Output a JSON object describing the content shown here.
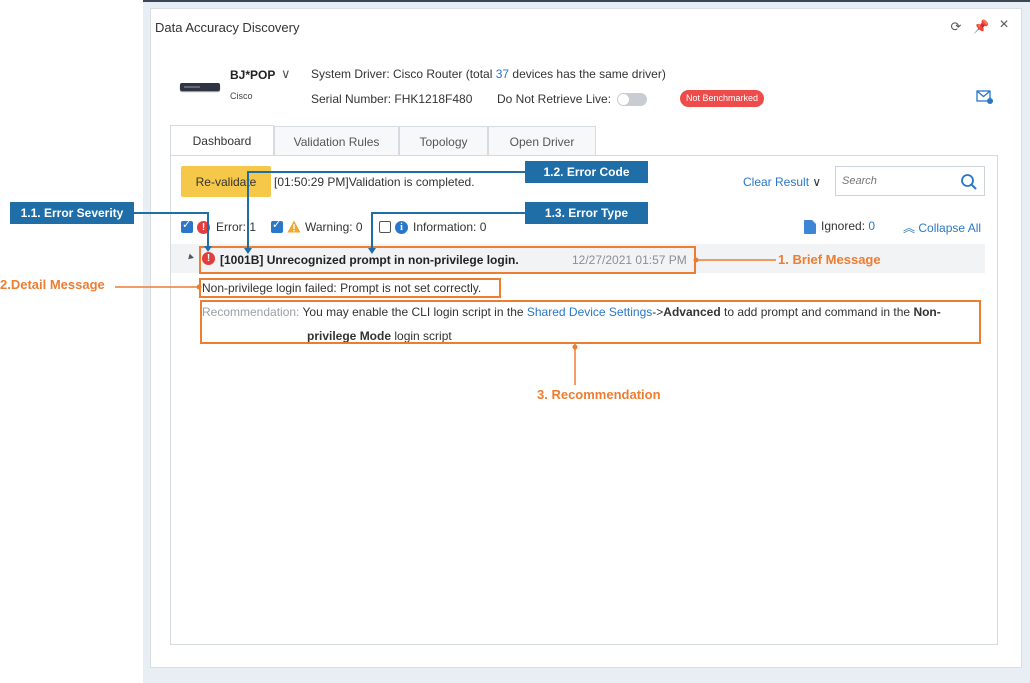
{
  "window": {
    "title": "Data Accuracy Discovery"
  },
  "device": {
    "name": "BJ*POP",
    "vendor": "Cisco",
    "driver_prefix": "System Driver: Cisco Router (total ",
    "driver_count": "37",
    "driver_suffix": " devices has the same driver)",
    "serial": "Serial Number: FHK1218F480",
    "retrieve_label": "Do Not Retrieve Live:",
    "status_badge": "Not Benchmarked"
  },
  "tabs": [
    {
      "label": "Dashboard"
    },
    {
      "label": "Validation Rules"
    },
    {
      "label": "Topology"
    },
    {
      "label": "Open Driver"
    }
  ],
  "toolbar": {
    "revalidate_label": "Re-validate",
    "status_text": "[01:50:29 PM]Validation is completed.",
    "clear_result_label": "Clear Result",
    "search_placeholder": "Search"
  },
  "filters": {
    "error_label": "Error: 1",
    "warning_label": "Warning: 0",
    "information_label": "Information: 0",
    "ignored_label": "Ignored: ",
    "ignored_count": "0",
    "collapse_label": "Collapse All"
  },
  "result": {
    "brief_message": "[1001B] Unrecognized prompt in non-privilege login.",
    "timestamp": "12/27/2021 01:57 PM",
    "detail_message": "Non-privilege login failed: Prompt is not set correctly.",
    "recommendation_label": "Recommendation:",
    "rec_text_1": " You may enable the CLI login script in the ",
    "rec_link": "Shared Device Settings",
    "rec_arrow": "->",
    "rec_bold_1": "Advanced",
    "rec_text_2": " to add prompt and command in the ",
    "rec_bold_2a": "Non-",
    "rec_bold_2b": "privilege Mode",
    "rec_text_3": " login script"
  },
  "annotations": {
    "error_severity": "1.1. Error Severity",
    "error_code": "1.2. Error Code",
    "error_type": "1.3. Error Type",
    "brief_message": "1. Brief Message",
    "detail_message": "2.Detail Message",
    "recommendation": "3. Recommendation"
  },
  "colors": {
    "accent": "#2a77c9",
    "callout_blue": "#1f6ea8",
    "callout_orange": "#ed7d31",
    "revalidate": "#f5c84a",
    "error_red": "#e43d3d",
    "badge_red": "#ee4b4b"
  }
}
